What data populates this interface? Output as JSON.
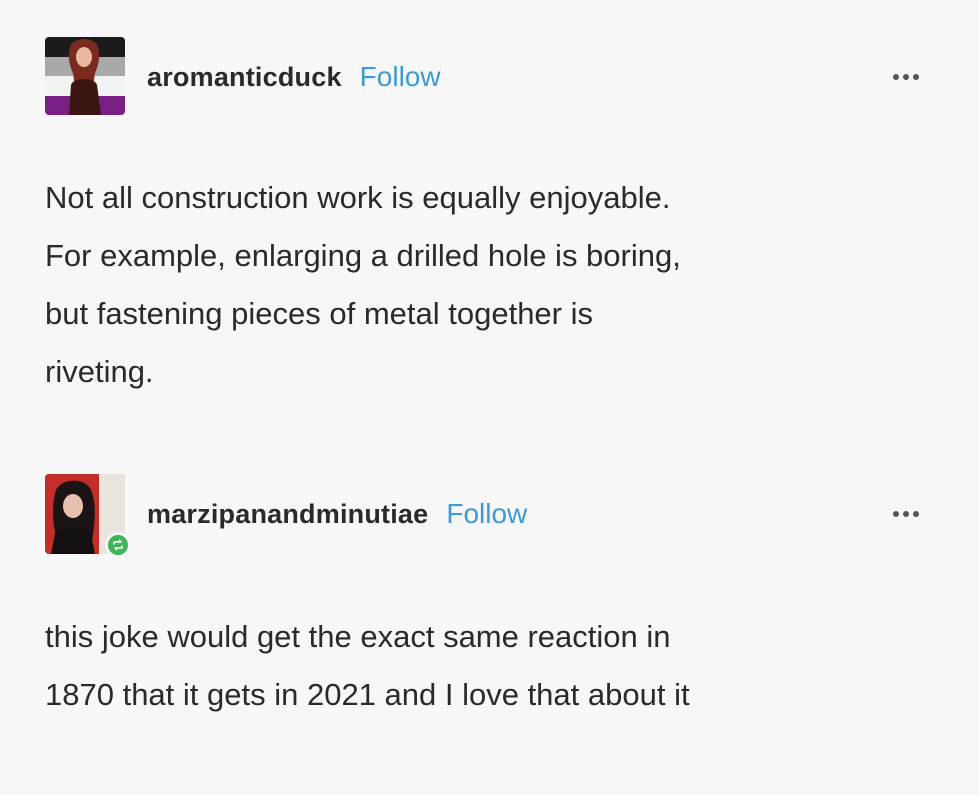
{
  "posts": [
    {
      "username": "aromanticduck",
      "follow_label": "Follow",
      "text_lines": [
        "Not all construction work is equally enjoyable.",
        "For example, enlarging a drilled hole is boring,",
        "but fastening pieces of metal together is",
        "riveting."
      ],
      "avatar_icon": "avatar-icon",
      "more_icon": "more-options-icon"
    },
    {
      "username": "marzipanandminutiae",
      "follow_label": "Follow",
      "text_lines": [
        "this joke would get the exact same reaction in",
        "1870 that it gets in 2021 and I love that about it"
      ],
      "avatar_icon": "avatar-icon",
      "badge_icon": "reblog-icon",
      "more_icon": "more-options-icon"
    }
  ],
  "colors": {
    "background": "#f7f7f7",
    "follow_link": "#3d9ad6",
    "reblog_badge": "#3fb55b"
  }
}
